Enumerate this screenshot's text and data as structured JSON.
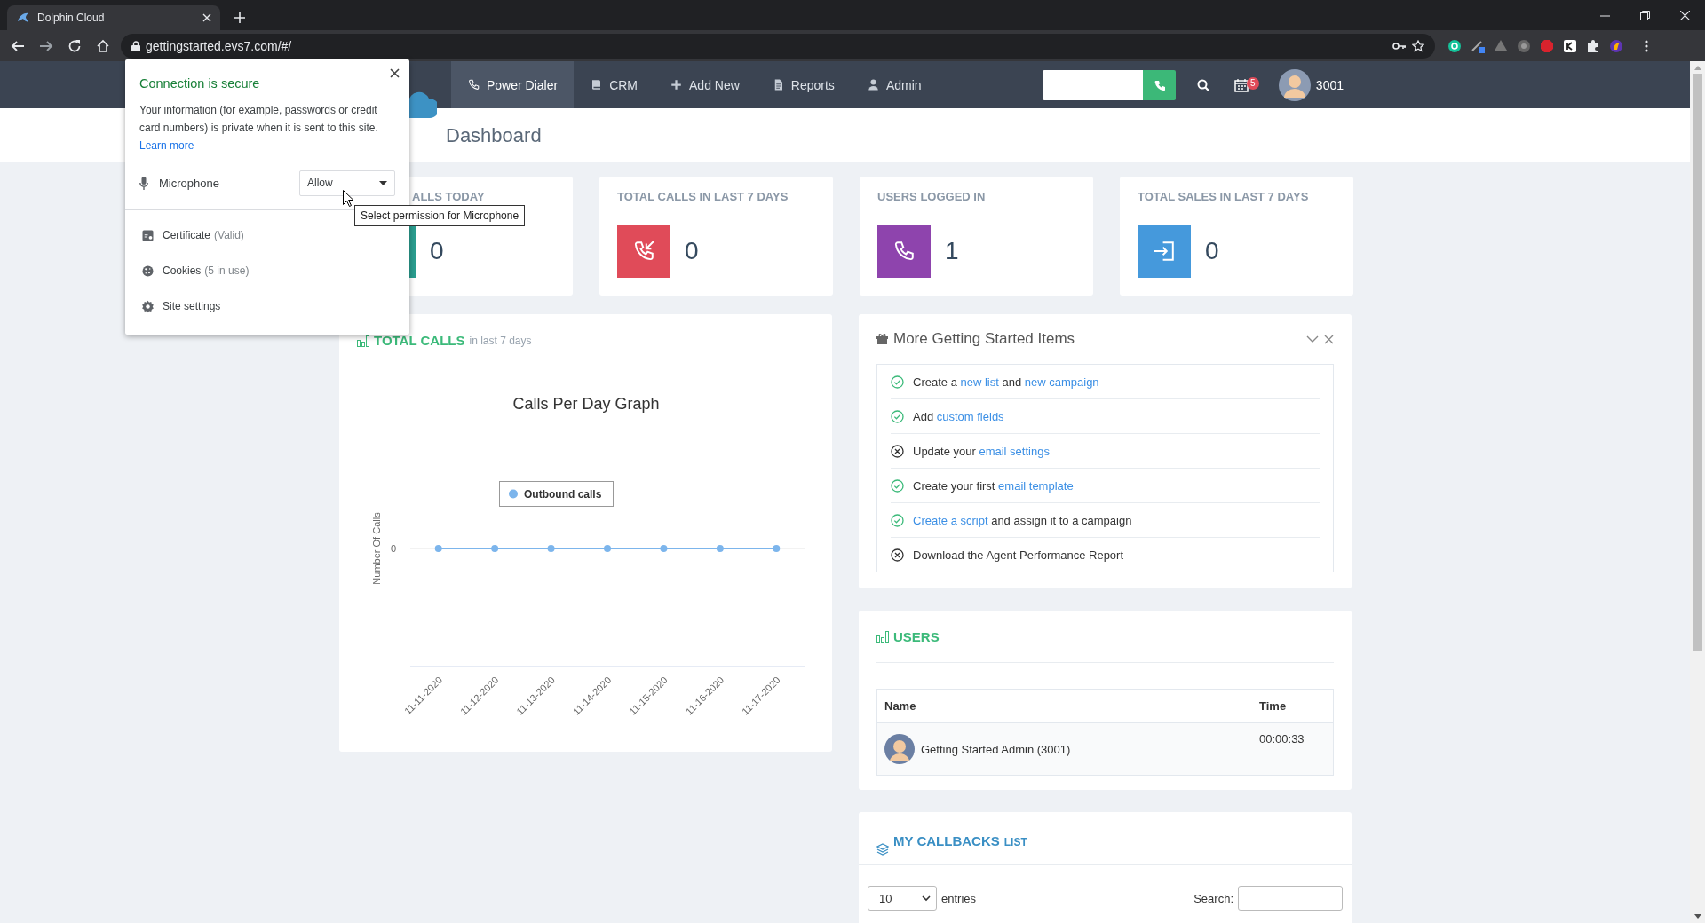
{
  "browser": {
    "tab_title": "Dolphin Cloud",
    "address": "gettingstarted.evs7.com/#/"
  },
  "navbar": {
    "items": [
      {
        "label": "Power Dialer",
        "selected": true
      },
      {
        "label": "CRM",
        "selected": false
      },
      {
        "label": "Add New",
        "selected": false
      },
      {
        "label": "Reports",
        "selected": false
      },
      {
        "label": "Admin",
        "selected": false
      }
    ],
    "calendar_badge": "5",
    "user": "3001"
  },
  "page_title": "Dashboard",
  "stats": [
    {
      "label": "ALLS TODAY",
      "value": "0",
      "color": "#2a9d8f"
    },
    {
      "label": "TOTAL CALLS IN LAST 7 DAYS",
      "value": "0",
      "color": "#e04b59"
    },
    {
      "label": "USERS LOGGED IN",
      "value": "1",
      "color": "#8e44ad"
    },
    {
      "label": "TOTAL SALES IN LAST 7 DAYS",
      "value": "0",
      "color": "#4599dc"
    }
  ],
  "total_calls": {
    "title": "TOTAL CALLS",
    "subtitle": "in last 7 days",
    "graph": {
      "title": "Calls Per Day Graph",
      "y_axis_title": "Number Of Calls",
      "y_tick_label": "0",
      "legend": "Outbound calls",
      "dates": [
        "11-11-2020",
        "11-12-2020",
        "11-13-2020",
        "11-14-2020",
        "11-15-2020",
        "11-16-2020",
        "11-17-2020"
      ]
    }
  },
  "getting_started": {
    "title": "More Getting Started Items",
    "items": [
      {
        "done": true,
        "parts": [
          {
            "kind": "text",
            "text": "Create a "
          },
          {
            "kind": "link",
            "text": "new list"
          },
          {
            "kind": "text",
            "text": " and "
          },
          {
            "kind": "link",
            "text": "new campaign"
          }
        ]
      },
      {
        "done": true,
        "parts": [
          {
            "kind": "text",
            "text": "Add "
          },
          {
            "kind": "link",
            "text": "custom fields"
          }
        ]
      },
      {
        "done": false,
        "parts": [
          {
            "kind": "text",
            "text": "Update your "
          },
          {
            "kind": "link",
            "text": "email settings"
          }
        ]
      },
      {
        "done": true,
        "parts": [
          {
            "kind": "text",
            "text": "Create your first "
          },
          {
            "kind": "link",
            "text": "email template"
          }
        ]
      },
      {
        "done": true,
        "parts": [
          {
            "kind": "link",
            "text": "Create a script"
          },
          {
            "kind": "text",
            "text": " and assign it to a campaign"
          }
        ]
      },
      {
        "done": false,
        "parts": [
          {
            "kind": "text",
            "text": "Download the Agent Performance Report"
          }
        ]
      }
    ]
  },
  "users": {
    "title": "USERS",
    "columns": [
      "Name",
      "Time"
    ],
    "rows": [
      {
        "name": "Getting Started Admin (3001)",
        "time": "00:00:33"
      }
    ]
  },
  "callbacks": {
    "title": "MY CALLBACKS",
    "title_suffix": "LIST",
    "page_size": "10",
    "entries_label": "entries",
    "search_label": "Search:"
  },
  "site_info": {
    "title": "Connection is secure",
    "body": "Your information (for example, passwords or credit card numbers) is private when it is sent to this site.",
    "link": "Learn more",
    "permission": {
      "label": "Microphone",
      "value": "Allow"
    },
    "items": [
      {
        "label": "Certificate",
        "status": "(Valid)"
      },
      {
        "label": "Cookies",
        "status": "(5 in use)"
      },
      {
        "label": "Site settings"
      }
    ],
    "tooltip": "Select permission for Microphone"
  }
}
